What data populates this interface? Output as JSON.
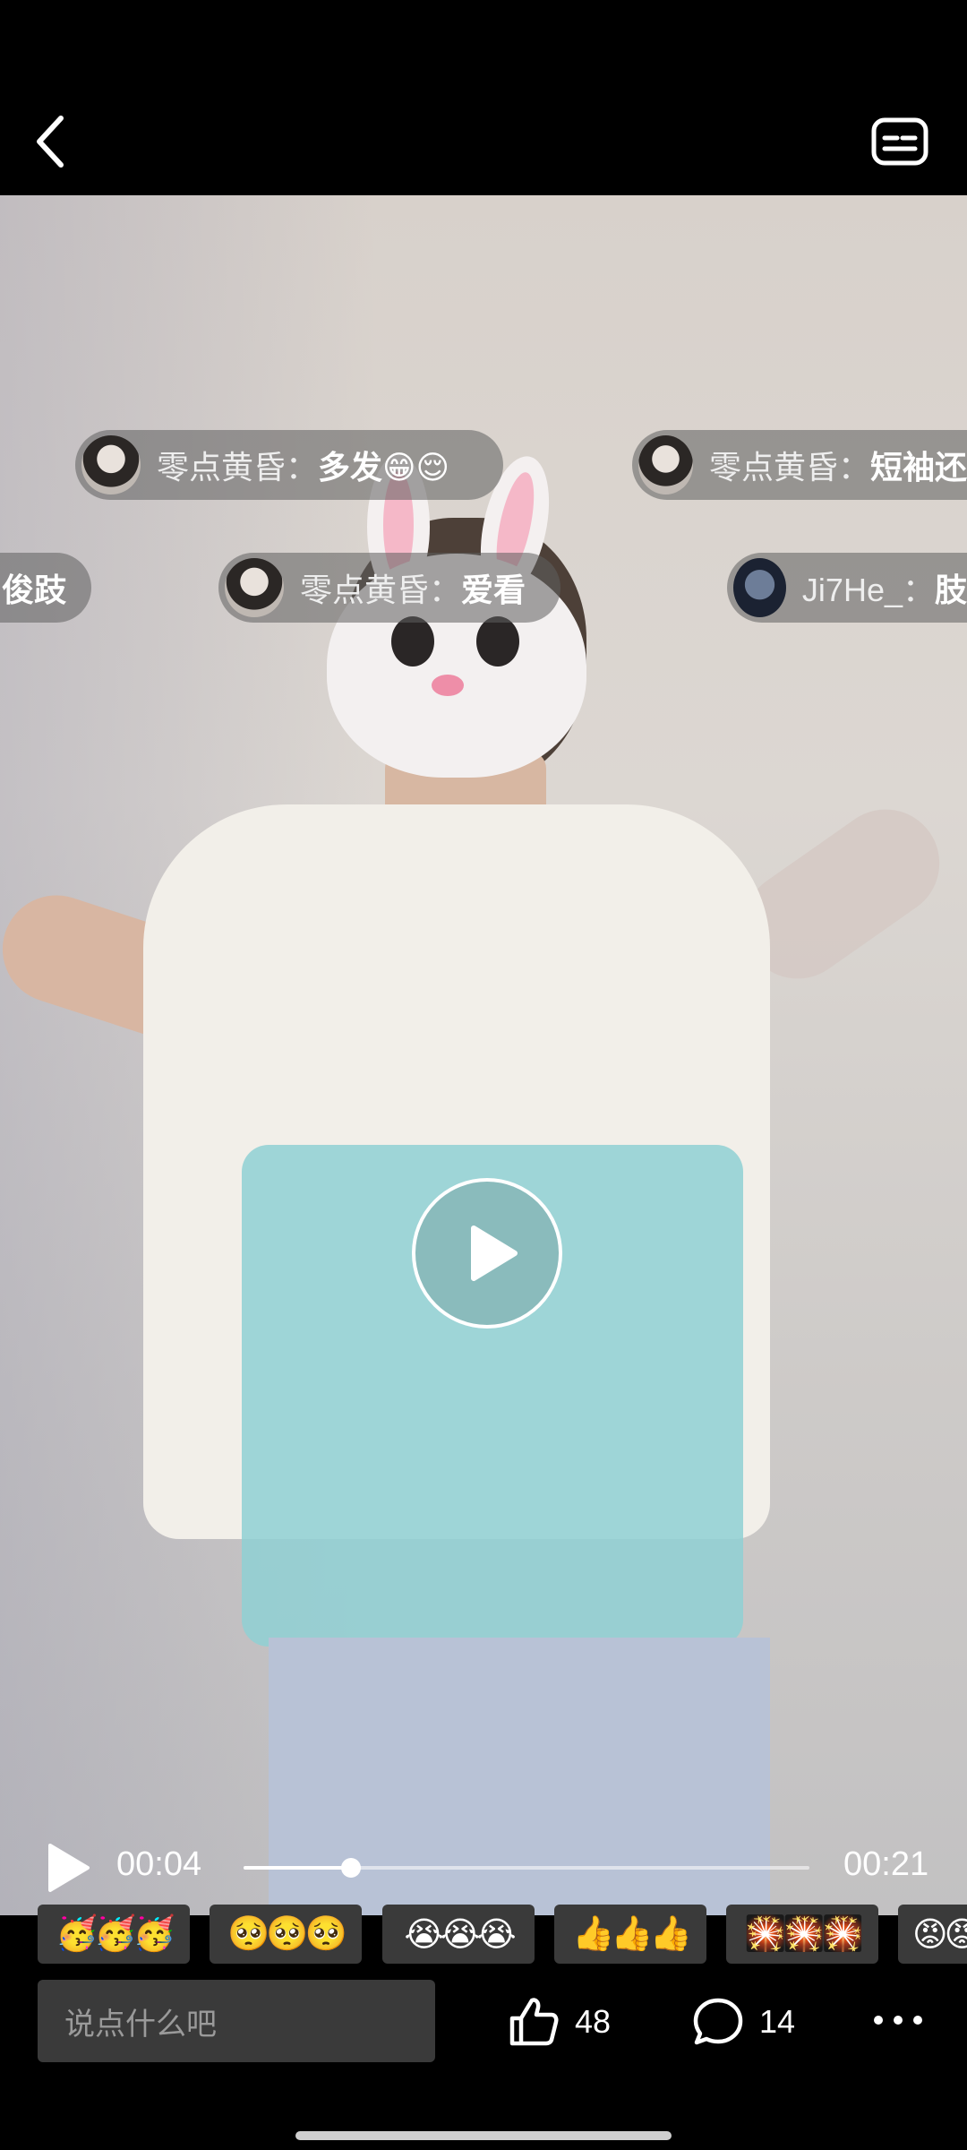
{
  "header": {
    "back_icon": "chevron-left-icon",
    "subtitle_icon": "subtitles-icon"
  },
  "danmaku": [
    {
      "user": "零点黄昏：",
      "message": "多发😁😌"
    },
    {
      "user": "零点黄昏：",
      "message": "短袖还"
    },
    {
      "user": "",
      "message": "俊跂"
    },
    {
      "user": "零点黄昏：",
      "message": "爱看"
    },
    {
      "user": "Ji7He_：",
      "message": "肢"
    }
  ],
  "player": {
    "current_time": "00:04",
    "total_time": "00:21",
    "progress": 0.19
  },
  "reactions": [
    "🥳🥳🥳",
    "🥺🥺🥺",
    "😭😭😭",
    "👍👍👍",
    "🎇🎇🎇",
    "😡😡😡"
  ],
  "bottom": {
    "comment_placeholder": "说点什么吧",
    "like_count": "48",
    "comment_count": "14"
  },
  "colors": {
    "background": "#000000",
    "chip": "#3a3a3a",
    "danmaku_bubble": "#5f5f5f"
  }
}
